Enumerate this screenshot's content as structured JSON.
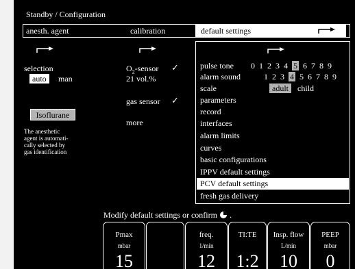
{
  "header": {
    "title": "Standby / Configuration"
  },
  "tabs": [
    {
      "label": "anesth. agent"
    },
    {
      "label": "calibration"
    },
    {
      "label": "default settings"
    }
  ],
  "left": {
    "selection_label": "selection",
    "auto": "auto",
    "man": "man",
    "agent_button": "Isoflurane",
    "note_lines": [
      "The anesthetic",
      "agent is automati-",
      "cally selected by",
      "gas identification"
    ]
  },
  "middle": {
    "o2_label": "O",
    "o2_sub": "2",
    "o2_rest": "-sensor",
    "o2_value": "21 vol.%",
    "gas_sensor": "gas sensor",
    "check": "✓",
    "more": "more"
  },
  "menu": {
    "pulse_tone": {
      "label": "pulse tone",
      "values": [
        "0",
        "1",
        "2",
        "3",
        "4",
        "5",
        "6",
        "7",
        "8",
        "9"
      ],
      "selected": "5"
    },
    "alarm_sound": {
      "label": "alarm sound",
      "values": [
        "1",
        "2",
        "3",
        "4",
        "5",
        "6",
        "7",
        "8",
        "9"
      ],
      "selected": "4"
    },
    "scale": {
      "label": "scale",
      "adult": "adult",
      "child": "child"
    },
    "items": [
      "parameters",
      "record",
      "interfaces",
      "alarm limits",
      "curves",
      "basic configurations",
      "IPPV default settings",
      "PCV default settings",
      "fresh gas delivery"
    ],
    "selected_item": "PCV default settings"
  },
  "prompt": {
    "text": "Modify default settings or confirm"
  },
  "params": [
    {
      "label": "Pmax",
      "unit": "mbar",
      "value": "15"
    },
    {
      "label": "",
      "unit": "",
      "value": ""
    },
    {
      "label": "freq.",
      "unit": "1/min",
      "value": "12"
    },
    {
      "label": "TI:TE",
      "unit": "",
      "value": "1:2"
    },
    {
      "label": "Insp. flow",
      "unit": "L/min",
      "value": "10"
    },
    {
      "label": "PEEP",
      "unit": "mbar",
      "value": "0"
    }
  ]
}
